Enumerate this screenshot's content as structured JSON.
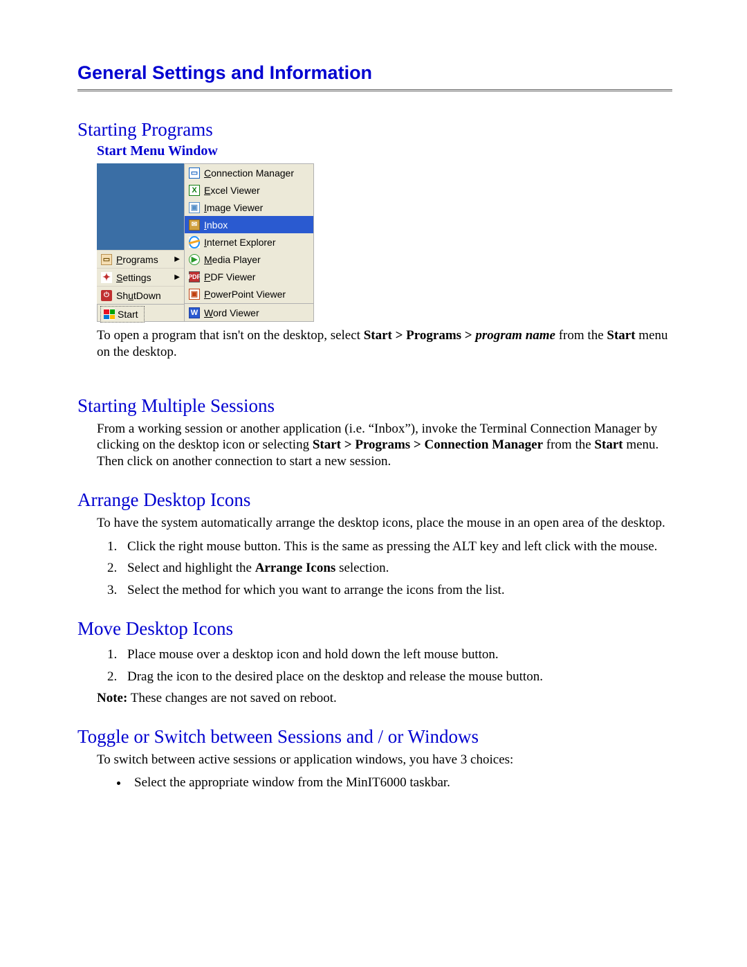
{
  "title": "General Settings and Information",
  "sections": {
    "starting_programs": {
      "heading": "Starting Programs",
      "subhead": "Start Menu Window",
      "para_html": "To open a program that isn't on the desktop, select <b>Start > Programs ></b> <b><i>program name</i></b> from the <b>Start</b> menu on the desktop."
    },
    "multiple_sessions": {
      "heading": "Starting Multiple Sessions",
      "para_html": "From a working session or another application (i.e. “Inbox”), invoke the Terminal Connection Manager by clicking on the desktop icon or selecting <b>Start > Programs > Connection Manager</b> from the <b>Start</b> menu.  Then click on another connection to start a new session."
    },
    "arrange_icons": {
      "heading": "Arrange Desktop Icons",
      "intro": "To have the system automatically arrange the desktop icons, place the mouse in an open area of the desktop.",
      "steps": [
        "Click the right mouse button.  This is the same as pressing the ALT key and left click with the mouse.",
        "Select and highlight the <b>Arrange Icons</b> selection.",
        "Select the method for which you want to arrange the icons from the list."
      ]
    },
    "move_icons": {
      "heading": "Move Desktop Icons",
      "steps": [
        "Place mouse over a desktop icon and hold down the left mouse button.",
        "Drag the icon to the desired place on the desktop and release the mouse button."
      ],
      "note_html": "<b>Note:</b>  These changes are not saved on reboot."
    },
    "toggle": {
      "heading": "Toggle or Switch between Sessions and / or Windows",
      "intro": "To switch between active sessions or application windows, you have 3 choices:",
      "bullets": [
        "Select the appropriate window from the MinIT6000 taskbar."
      ]
    }
  },
  "start_menu": {
    "left_items": [
      {
        "label_html": "<u>P</u>rograms",
        "icon": "prog",
        "arrow": true
      },
      {
        "label_html": "<u>S</u>ettings",
        "icon": "set",
        "arrow": true
      },
      {
        "label_html": "Sh<u>u</u>tDown",
        "icon": "shut",
        "arrow": false
      }
    ],
    "right_items": [
      {
        "label": "Connection Manager",
        "icon": "conn",
        "selected": false
      },
      {
        "label": "Excel Viewer",
        "icon": "xls",
        "selected": false
      },
      {
        "label": "Image Viewer",
        "icon": "img",
        "selected": false
      },
      {
        "label": "Inbox",
        "icon": "inbox",
        "selected": true
      },
      {
        "label": "Internet Explorer",
        "icon": "ie",
        "selected": false
      },
      {
        "label": "Media Player",
        "icon": "media",
        "selected": false
      },
      {
        "label": "PDF Viewer",
        "icon": "pdf",
        "selected": false
      },
      {
        "label": "PowerPoint Viewer",
        "icon": "ppt",
        "selected": false
      },
      {
        "label": "Word Viewer",
        "icon": "word",
        "selected": false
      }
    ],
    "start_label": "Start"
  }
}
